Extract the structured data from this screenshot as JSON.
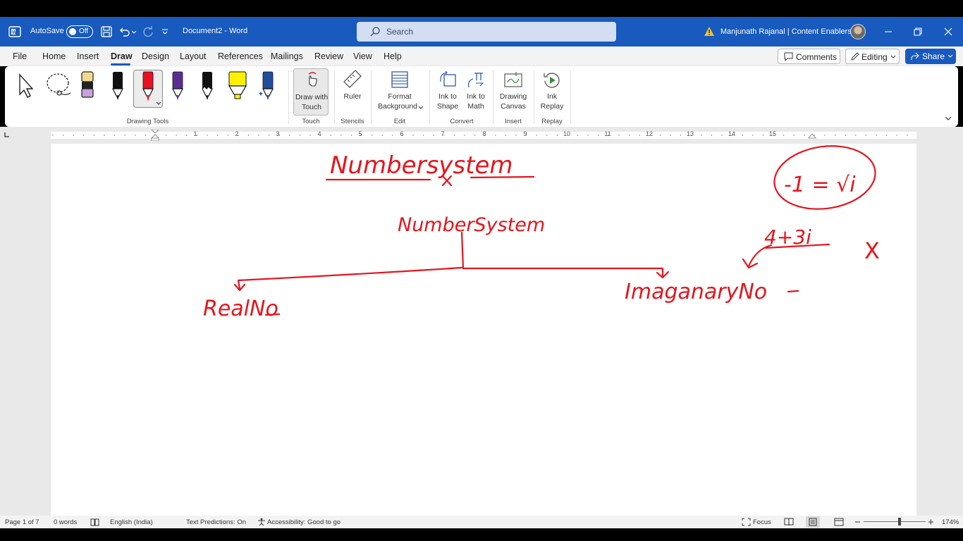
{
  "titlebar": {
    "autosave_label": "AutoSave",
    "autosave_state": "Off",
    "document_title": "Document2  -  Word",
    "search_placeholder": "Search",
    "user_name": "Manjunath Rajanal | Content Enablers"
  },
  "menu": {
    "items": [
      "File",
      "Home",
      "Insert",
      "Draw",
      "Design",
      "Layout",
      "References",
      "Mailings",
      "Review",
      "View",
      "Help"
    ],
    "active": "Draw",
    "comments_label": "Comments",
    "editing_label": "Editing",
    "share_label": "Share"
  },
  "ribbon": {
    "groups": {
      "drawing_tools": "Drawing Tools",
      "touch": "Touch",
      "stencils": "Stencils",
      "edit": "Edit",
      "convert": "Convert",
      "insert": "Insert",
      "replay": "Replay"
    },
    "buttons": {
      "draw_with_touch_1": "Draw with",
      "draw_with_touch_2": "Touch",
      "ruler": "Ruler",
      "format_background_1": "Format",
      "format_background_2": "Background",
      "ink_to_shape_1": "Ink to",
      "ink_to_shape_2": "Shape",
      "ink_to_math_1": "Ink to",
      "ink_to_math_2": "Math",
      "drawing_canvas_1": "Drawing",
      "drawing_canvas_2": "Canvas",
      "ink_replay_1": "Ink",
      "ink_replay_2": "Replay"
    },
    "pen_colors": [
      "#111111",
      "#e81123",
      "#5c2d91",
      "#111111",
      "#fff100",
      "#1f4e9c"
    ],
    "highlighter_color": "#f3d98b"
  },
  "ruler": {
    "numbers": [
      "1",
      "2",
      "3",
      "4",
      "5",
      "6",
      "7",
      "8",
      "9",
      "10",
      "11",
      "12",
      "13",
      "14",
      "15"
    ]
  },
  "ink": {
    "color": "#e3161d",
    "title": "Numbersystem",
    "heading": "NumberSystem",
    "left_branch": "RealNo",
    "right_branch": "ImaganaryNo",
    "formula": "-1 = √i",
    "example": "4+3i",
    "mark": "X"
  },
  "statusbar": {
    "page": "Page 1 of 7",
    "words": "0 words",
    "language": "English (India)",
    "text_predictions": "Text Predictions: On",
    "accessibility": "Accessibility: Good to go",
    "focus": "Focus",
    "zoom": "174%"
  }
}
